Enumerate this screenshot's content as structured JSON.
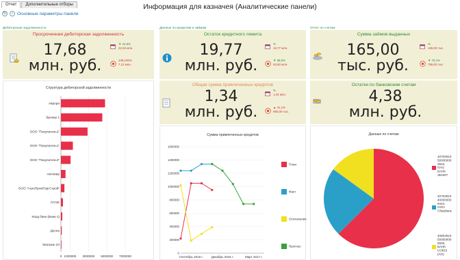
{
  "tabs": [
    "Отчет",
    "Дополнительные отборы"
  ],
  "title": "Информация для казначея (Аналитические панели)",
  "params_label": "Основные параметры панели",
  "sections": {
    "debt": "Дебиторская задолженность",
    "credit": "Данные по кредитам и займам",
    "accounts": "Отчет по счетам"
  },
  "cards": {
    "overdue": {
      "title": "Просроченная дебиторская задолженность",
      "value": "17,68",
      "unit": "млн. руб.",
      "i1_arrow": "▼",
      "i1_pct": "22,9%",
      "i1_val": "22,94 млн.",
      "i2_pct": "248,245%",
      "i2_val": "7,12 млн."
    },
    "credit_limit": {
      "title": "Остаток кредитного лимита",
      "value": "19,77",
      "unit": "млн. руб.",
      "i1_pct": "%",
      "i1_val": "19,77 млн.",
      "i2_arrow": "▼",
      "i2_pct": "68,9%",
      "i2_val": "63,60 млн."
    },
    "loans": {
      "title": "Сумма займов выданных",
      "value": "165,00",
      "unit": "тыс. руб.",
      "i1_pct": "%",
      "i1_val": "165,00 тыс.",
      "i2_arrow": "▼",
      "i2_pct": "78,1%",
      "i2_val": "755,00 тыс."
    },
    "attracted": {
      "title": "Общая сумма привлеченных кредитов",
      "value": "1,34",
      "unit": "млн. руб.",
      "i1_pct": "%",
      "i1_val": "1,34 млн.",
      "i2_arrow": "▲",
      "i2_pct": "41,1%",
      "i2_val": "950,00 тыс."
    },
    "bank": {
      "title": "Остатки по банковским счетам",
      "value": "4,38",
      "unit": "млн. руб."
    }
  },
  "colors": {
    "bar": "#e8304a",
    "plan": "#e8304a",
    "fact": "#2aa0c8",
    "deviation": "#f0e020",
    "forecast": "#3aa040"
  },
  "chart_data": [
    {
      "type": "bar",
      "title": "Структура дебиторской задолженности",
      "categories": [
        "Аврора",
        "Брокер 1",
        "ООО \"Покупатель2\"",
        "ООО \"Покупатель1\"",
        "ООО \"Покупатель3\"",
        "Автомир",
        "ООО \"АгроПромТоргСтрой\"",
        "NYSE",
        "Хвод банк (Банк-1)",
        "Десна",
        "Магазин 23"
      ],
      "values": [
        4800000,
        4500000,
        2900000,
        1300000,
        1050000,
        500000,
        380000,
        220000,
        150000,
        90000,
        60000
      ],
      "xticks": [
        "0",
        "1000000",
        "3000000",
        "5000000",
        "7000000"
      ],
      "xtick_values": [
        0,
        1000000,
        3000000,
        5000000,
        7000000
      ],
      "xlim": [
        0,
        7000000
      ],
      "orientation": "horizontal"
    },
    {
      "type": "line",
      "title": "Сумма привлеченных кредитов",
      "yticks": [
        "0",
        "200000",
        "400000",
        "600000",
        "800000",
        "1000000",
        "1200000",
        "1400000",
        "1600000"
      ],
      "ylim": [
        0,
        1600000
      ],
      "xticks": [
        "Сентябрь 2016 г.",
        "Декабрь 2016 г.",
        "Март 2017 г."
      ],
      "xtick_positions": [
        1,
        4,
        7
      ],
      "xlim": [
        0,
        8
      ],
      "series": [
        {
          "name": "План",
          "x": [
            0,
            1,
            2,
            3
          ],
          "values": [
            220000,
            1050000,
            1050000,
            950000
          ]
        },
        {
          "name": "Факт",
          "x": [
            0,
            1,
            2,
            3
          ],
          "values": [
            1240000,
            1240000,
            1340000,
            1340000
          ]
        },
        {
          "name": "Отклонение",
          "x": [
            0,
            1,
            2,
            3
          ],
          "values": [
            1020000,
            190000,
            290000,
            390000
          ]
        },
        {
          "name": "Прогноз",
          "x": [
            3,
            4,
            5,
            6,
            7
          ],
          "values": [
            1340000,
            1240000,
            1040000,
            740000,
            740000
          ]
        }
      ],
      "legend": [
        "План",
        "Факт",
        "Отклонение",
        "Прогноз"
      ],
      "legend_placement": "right"
    },
    {
      "type": "pie",
      "title": "Данные по счетам",
      "labels": [
        "40702810 50000000 3822, ПАО БАНК ЗЕНИТ",
        "40702810 40000000 9444, ООО Сбербанк",
        "40802810 50000000 0000, БАНК СОЮЗ (АО)"
      ],
      "values": [
        0.625,
        0.225,
        0.15
      ],
      "colors": [
        "#e8304a",
        "#2aa0c8",
        "#f0e020"
      ],
      "legend_placement": "right"
    }
  ]
}
